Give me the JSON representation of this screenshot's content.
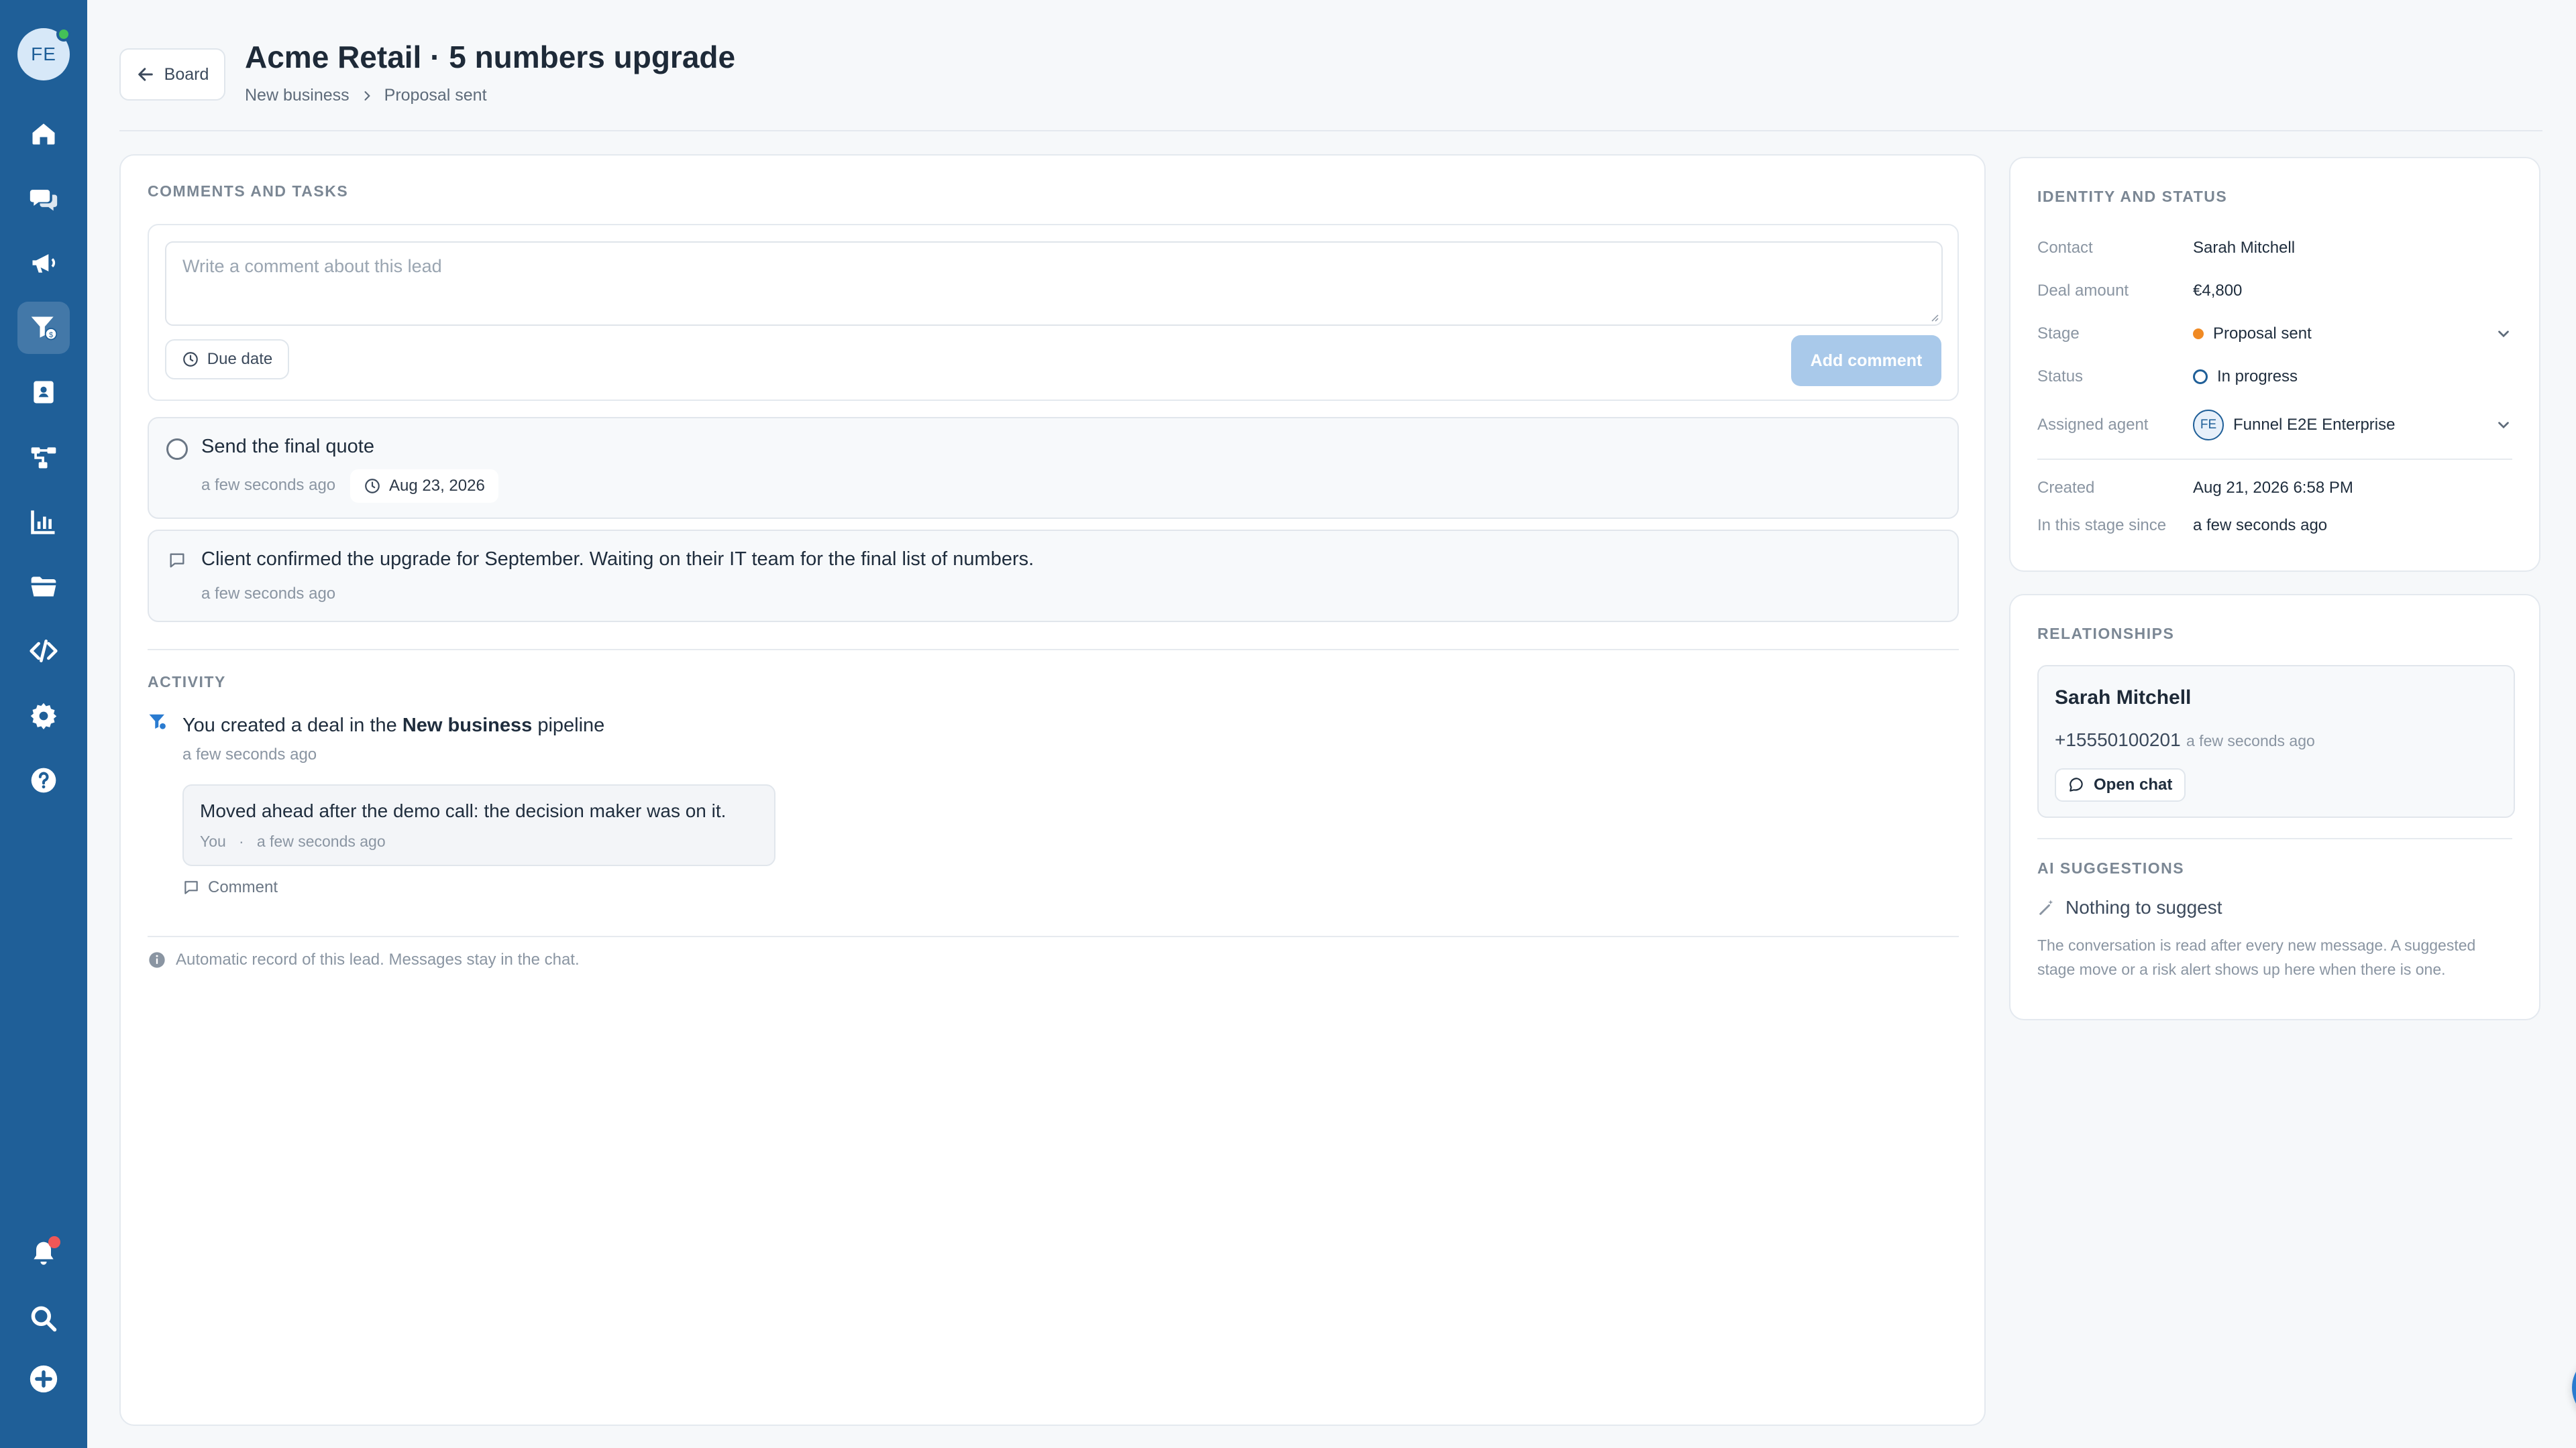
{
  "sidebar": {
    "avatar_initials": "FE",
    "items": [
      {
        "name": "home-icon"
      },
      {
        "name": "chat-icon"
      },
      {
        "name": "megaphone-icon"
      },
      {
        "name": "funnel-icon",
        "active": true
      },
      {
        "name": "contacts-book-icon"
      },
      {
        "name": "flow-icon"
      },
      {
        "name": "reports-icon"
      },
      {
        "name": "folder-icon"
      },
      {
        "name": "code-icon"
      },
      {
        "name": "gear-icon"
      },
      {
        "name": "help-icon"
      }
    ],
    "bottom_items": [
      {
        "name": "bell-icon",
        "has_notification": true
      },
      {
        "name": "search-icon"
      },
      {
        "name": "plus-circle-icon"
      }
    ]
  },
  "header": {
    "back_label": "Board",
    "title": "Acme Retail · 5 numbers upgrade",
    "breadcrumb": [
      "New business",
      "Proposal sent"
    ]
  },
  "comments": {
    "section_title": "COMMENTS AND TASKS",
    "placeholder": "Write a comment about this lead",
    "due_date_label": "Due date",
    "add_comment_label": "Add comment",
    "task": {
      "text": "Send the final quote",
      "time": "a few seconds ago",
      "due": "Aug 23, 2026"
    },
    "note": {
      "text": "Client confirmed the upgrade for September. Waiting on their IT team for the final list of numbers.",
      "time": "a few seconds ago"
    }
  },
  "activity": {
    "section_title": "ACTIVITY",
    "event": {
      "prefix": "You created a deal in the ",
      "pipeline": "New business",
      "suffix": " pipeline",
      "time": "a few seconds ago"
    },
    "bubble": {
      "text": "Moved ahead after the demo call: the decision maker was on it.",
      "author": "You",
      "separator": "·",
      "time": "a few seconds ago"
    },
    "comment_label": "Comment",
    "footer_note": "Automatic record of this lead. Messages stay in the chat."
  },
  "identity": {
    "section_title": "IDENTITY AND STATUS",
    "contact_label": "Contact",
    "contact": "Sarah Mitchell",
    "amount_label": "Deal amount",
    "amount": "€4,800",
    "stage_label": "Stage",
    "stage": "Proposal sent",
    "stage_color": "#f08a24",
    "status_label": "Status",
    "status": "In progress",
    "agent_label": "Assigned agent",
    "agent_initials": "FE",
    "agent": "Funnel E2E Enterprise",
    "created_label": "Created",
    "created": "Aug 21, 2026 6:58 PM",
    "since_label": "In this stage since",
    "since": "a few seconds ago"
  },
  "relationships": {
    "section_title": "RELATIONSHIPS",
    "name": "Sarah Mitchell",
    "phone": "+15550100201",
    "time": "a few seconds ago",
    "open_chat_label": "Open chat"
  },
  "ai": {
    "section_title": "AI SUGGESTIONS",
    "headline": "Nothing to suggest",
    "description": "The conversation is read after every new message. A suggested stage move or a risk alert shows up here when there is one."
  },
  "colors": {
    "sidebar": "#1f5f98",
    "accent": "#2a7bd0",
    "add_button_disabled": "#a9c9ea"
  }
}
